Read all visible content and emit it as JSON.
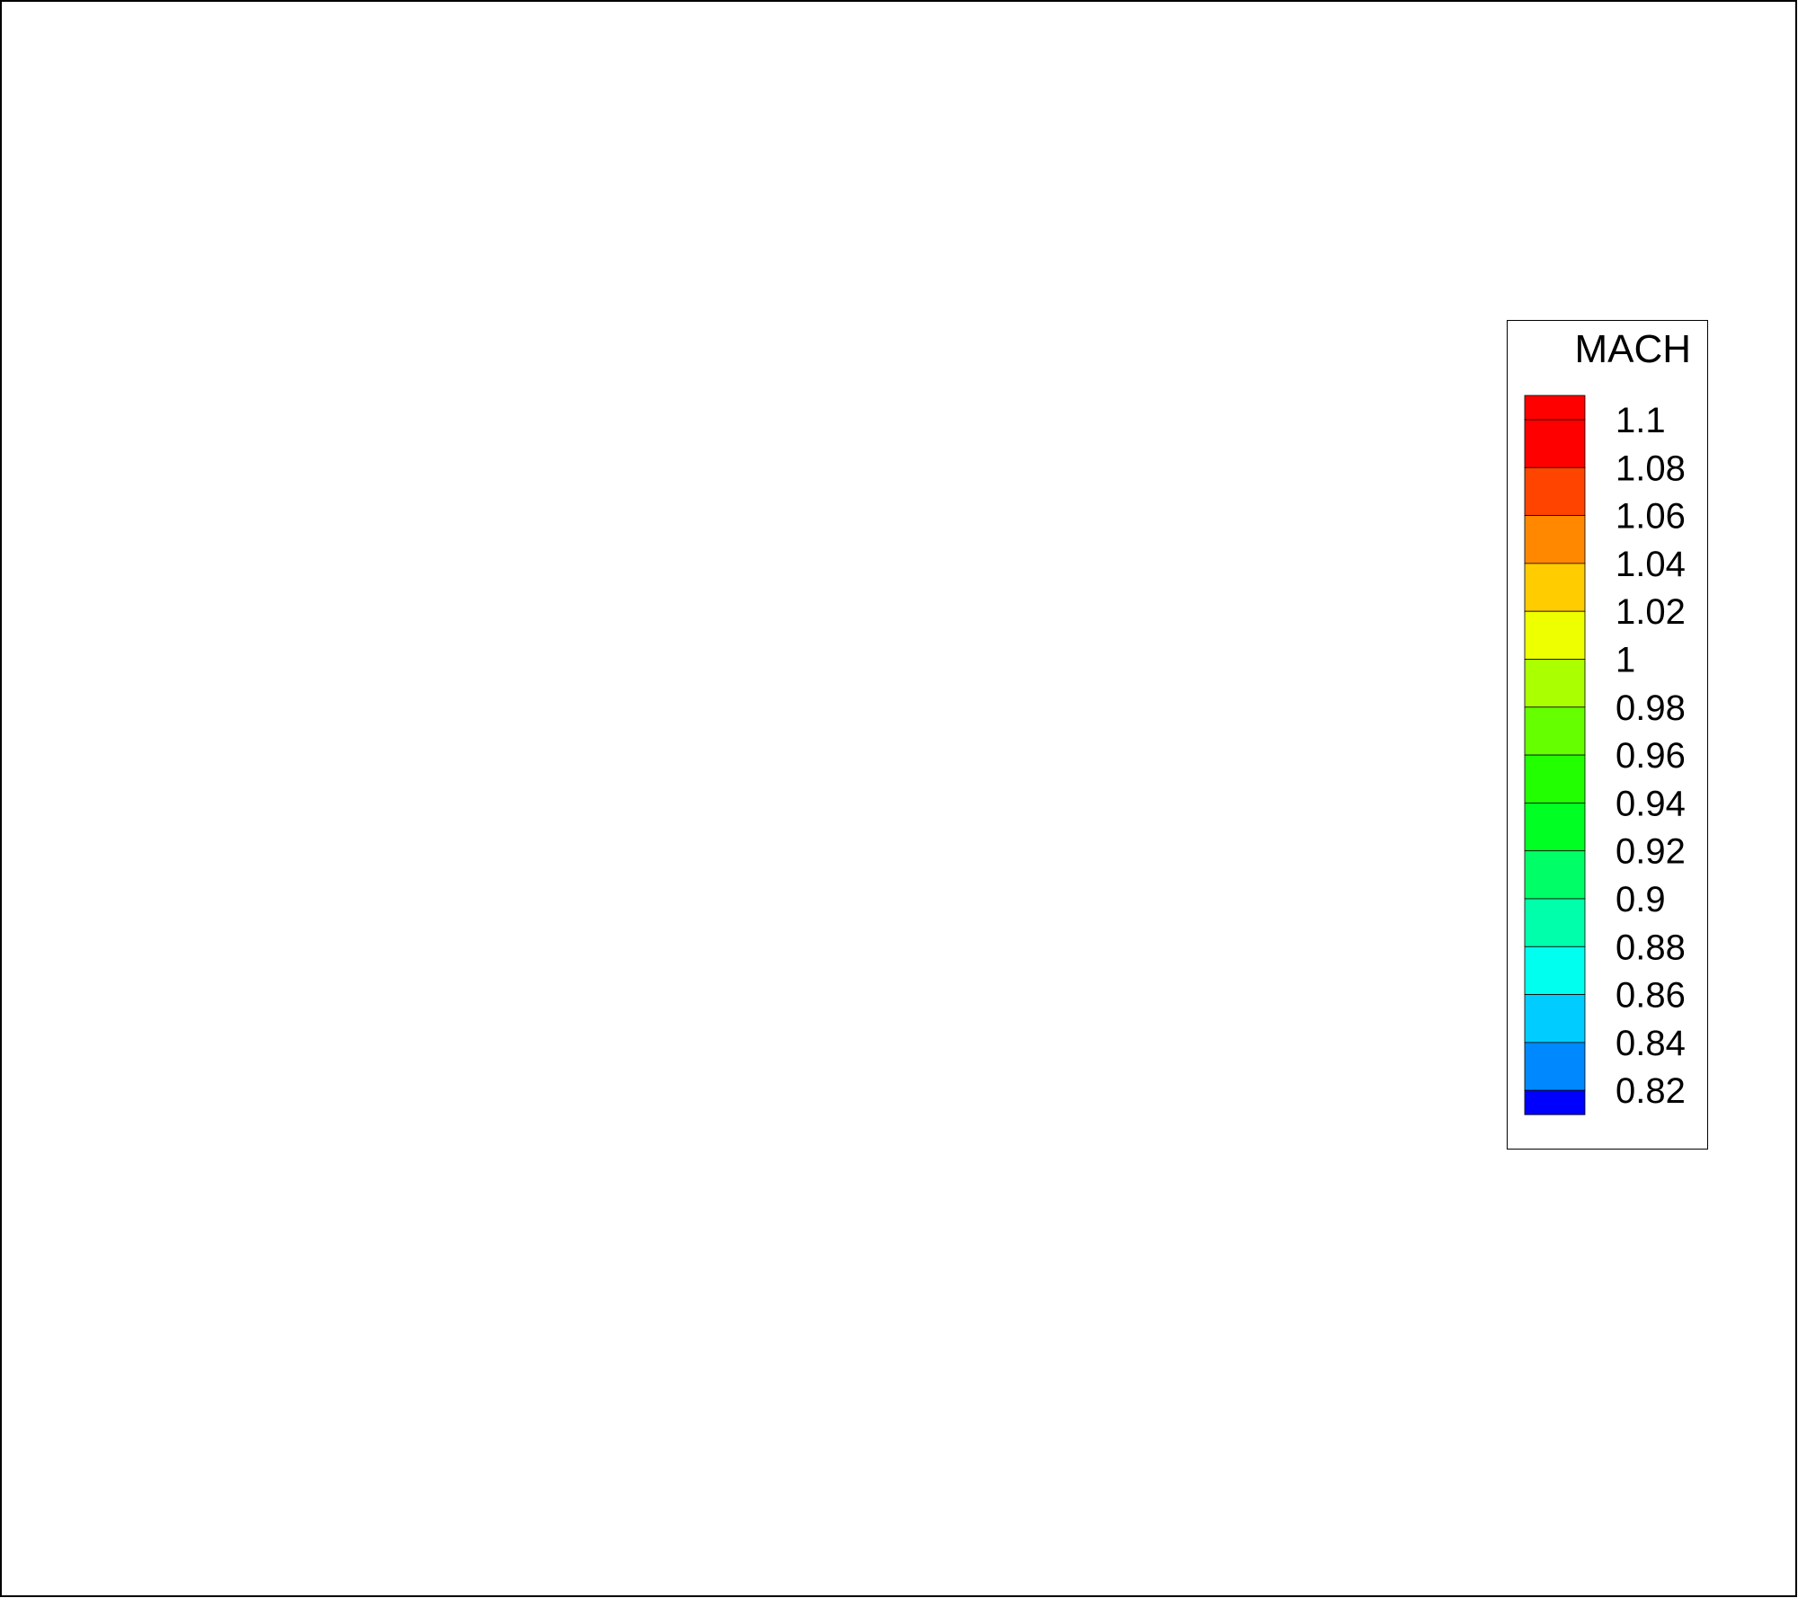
{
  "chart_data": {
    "type": "heatmap",
    "variable": "MACH",
    "legend": {
      "title": "MACH",
      "placement": "right",
      "levels": [
        {
          "label": "1.1",
          "value": 1.1,
          "color": "#ff0000"
        },
        {
          "label": "1.08",
          "value": 1.08,
          "color": "#ff4400"
        },
        {
          "label": "1.06",
          "value": 1.06,
          "color": "#ff8800"
        },
        {
          "label": "1.04",
          "value": 1.04,
          "color": "#ffcc00"
        },
        {
          "label": "1.02",
          "value": 1.02,
          "color": "#eeff00"
        },
        {
          "label": "1",
          "value": 1.0,
          "color": "#aaff00"
        },
        {
          "label": "0.98",
          "value": 0.98,
          "color": "#66ff00"
        },
        {
          "label": "0.96",
          "value": 0.96,
          "color": "#22ff00"
        },
        {
          "label": "0.94",
          "value": 0.94,
          "color": "#00ff22"
        },
        {
          "label": "0.92",
          "value": 0.92,
          "color": "#00ff66"
        },
        {
          "label": "0.9",
          "value": 0.9,
          "color": "#00ffaa"
        },
        {
          "label": "0.88",
          "value": 0.88,
          "color": "#00ffee"
        },
        {
          "label": "0.86",
          "value": 0.86,
          "color": "#00ccff"
        },
        {
          "label": "0.84",
          "value": 0.84,
          "color": "#0088ff"
        },
        {
          "label": "0.82",
          "value": 0.82,
          "color": "#0044ff"
        }
      ],
      "top_color": "#ff0000",
      "bottom_color": "#0000ff"
    },
    "field": []
  }
}
